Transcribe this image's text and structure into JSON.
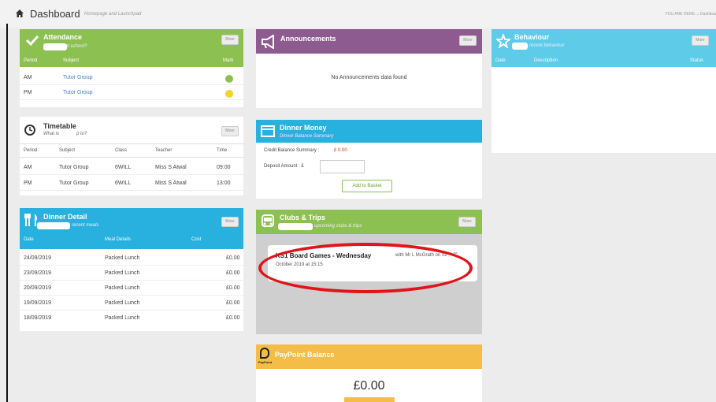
{
  "header": {
    "title": "Dashboard",
    "subtitle": "Homepage and Launchpad",
    "breadcrumb": "YOU ARE HERE:  ⌂ Dashboa"
  },
  "more_label": "More",
  "attendance": {
    "title": "Attendance",
    "subtitle": "at school?",
    "columns": [
      "Period",
      "Subject",
      "Mark"
    ],
    "rows": [
      {
        "period": "AM",
        "subject": "Tutor Group",
        "mark_color": "#8cc152"
      },
      {
        "period": "PM",
        "subject": "Tutor Group",
        "mark_color": "#f5d327"
      }
    ]
  },
  "timetable": {
    "title": "Timetable",
    "subtitle_a": "What is",
    "subtitle_b": "p to?",
    "columns": [
      "Period",
      "Subject",
      "Class",
      "Teacher",
      "Time"
    ],
    "rows": [
      {
        "period": "AM",
        "subject": "Tutor Group",
        "class": "6WILL",
        "teacher": "Miss S Atwal",
        "time": "09:00"
      },
      {
        "period": "PM",
        "subject": "Tutor Group",
        "class": "6WILL",
        "teacher": "Miss S Atwal",
        "time": "13:00"
      }
    ]
  },
  "dinner_detail": {
    "title": "Dinner Detail",
    "subtitle": "recent meals",
    "columns": [
      "Date",
      "Meal Details",
      "Cost"
    ],
    "rows": [
      {
        "date": "24/09/2019",
        "meal": "Packed Lunch",
        "cost": "£0.00"
      },
      {
        "date": "23/09/2019",
        "meal": "Packed Lunch",
        "cost": "£0.00"
      },
      {
        "date": "20/09/2019",
        "meal": "Packed Lunch",
        "cost": "£0.00"
      },
      {
        "date": "19/09/2019",
        "meal": "Packed Lunch",
        "cost": "£0.00"
      },
      {
        "date": "18/09/2019",
        "meal": "Packed Lunch",
        "cost": "£0.00"
      }
    ]
  },
  "announcements": {
    "title": "Announcements",
    "empty": "No Announcements data found"
  },
  "dinner_money": {
    "title": "Dinner Money",
    "subtitle": "Dinner Balance Summary",
    "credit_label": "Credit Balance Summary : ",
    "credit_value": "£ 0.00",
    "deposit_label": "Deposit Amount : £",
    "deposit_value": "",
    "add_button": "Add to Basket"
  },
  "clubs": {
    "title": "Clubs & Trips",
    "subtitle": "upcoming clubs & trips",
    "event_name": "KS1 Board Games - Wednesday",
    "event_with": "with Mr L McGrath on 02",
    "event_sup": "nd",
    "event_when": "October 2019 at 15:15"
  },
  "paypoint": {
    "title": "PayPoint Balance",
    "logo_text": "PayPoint",
    "balance": "£0.00"
  },
  "behaviour": {
    "title": "Behaviour",
    "subtitle": "recent behaviour",
    "columns": [
      "Date",
      "Description",
      "Status"
    ]
  },
  "colors": {
    "green": "#8cc152",
    "purple": "#8e5b91",
    "blue": "#28b0df",
    "cyan": "#5ecbe8",
    "orange": "#f4bd48",
    "annotation": "#e0141a"
  }
}
